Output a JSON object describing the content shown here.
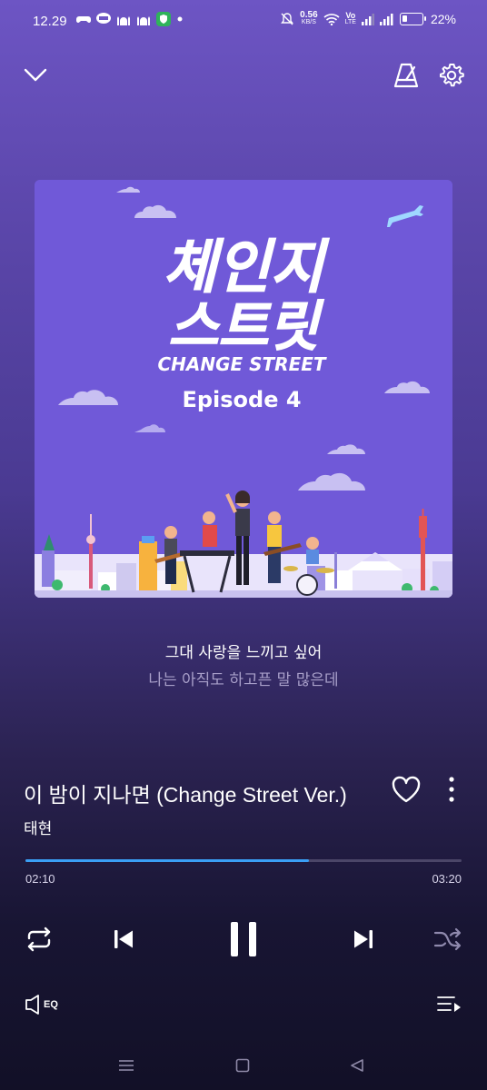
{
  "status_bar": {
    "time": "12.29",
    "net_speed_value": "0.56",
    "net_speed_unit": "KB/S",
    "volte": "Vo",
    "lte": "LTE",
    "battery": "22%"
  },
  "album": {
    "title_korean_line1": "체인지",
    "title_korean_line2": "스트릿",
    "title_english": "CHANGE STREET",
    "episode": "Episode 4"
  },
  "lyrics": {
    "current": "그대 사랑을 느끼고 싶어",
    "next": "나는 아직도 하고픈 말 많은데"
  },
  "track": {
    "title": "이 밤이 지나면 (Change Street Ver.)",
    "artist": "태현",
    "elapsed": "02:10",
    "duration": "03:20",
    "progress": 0.65
  },
  "bottom": {
    "eq_label": "EQ"
  },
  "colors": {
    "accent": "#3a9ff5",
    "album_bg": "#6f59d6"
  }
}
